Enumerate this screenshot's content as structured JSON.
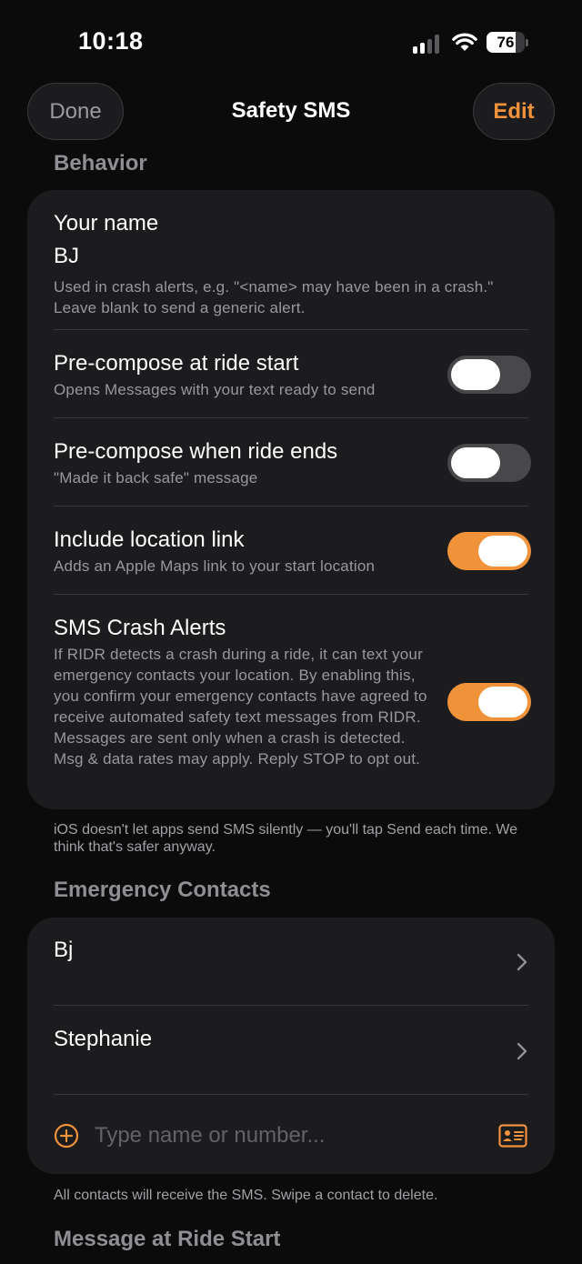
{
  "status_bar": {
    "time": "10:18",
    "battery_percent": "76",
    "battery_level": 0.76
  },
  "nav": {
    "done_label": "Done",
    "title": "Safety SMS",
    "edit_label": "Edit"
  },
  "behavior": {
    "section_title": "Behavior",
    "name_label": "Your name",
    "name_value": "BJ",
    "name_help": "Used in crash alerts, e.g. \"<name> may have been in a crash.\" Leave blank to send a generic alert.",
    "toggles": [
      {
        "label": "Pre-compose at ride start",
        "sub": "Opens Messages with your text ready to send",
        "on": false
      },
      {
        "label": "Pre-compose when ride ends",
        "sub": "\"Made it back safe\" message",
        "on": false
      },
      {
        "label": "Include location link",
        "sub": "Adds an Apple Maps link to your start location",
        "on": true
      },
      {
        "label": "SMS Crash Alerts",
        "sub": "If RIDR detects a crash during a ride, it can text your emergency contacts your location. By enabling this, you confirm your emergency contacts have agreed to receive automated safety text messages from RIDR. Messages are sent only when a crash is detected. Msg & data rates may apply. Reply STOP to opt out.",
        "on": true
      }
    ],
    "footnote": "iOS doesn't let apps send SMS silently — you'll tap Send each time. We think that's safer anyway."
  },
  "emergency_contacts": {
    "section_title": "Emergency Contacts",
    "contacts": [
      "Bj",
      "Stephanie"
    ],
    "add_placeholder": "Type name or number...",
    "footnote": "All contacts will receive the SMS. Swipe a contact to delete."
  },
  "message_at_ride_start": {
    "section_title": "Message at Ride Start"
  },
  "colors": {
    "accent": "#f0923a",
    "background": "#0b0b0c",
    "card": "#1c1c1e",
    "toggle_off": "#48484a"
  }
}
